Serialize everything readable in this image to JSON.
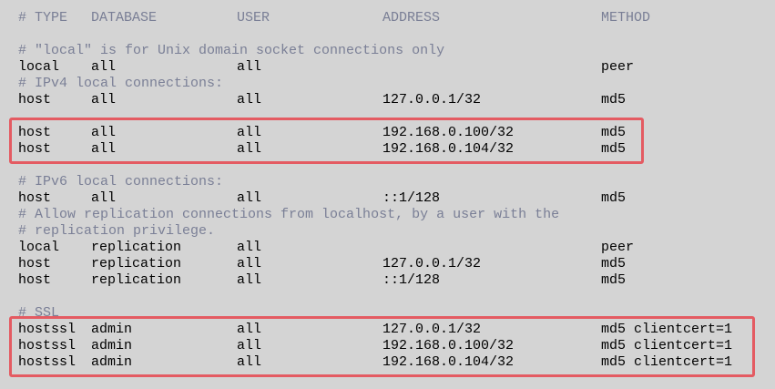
{
  "header": {
    "type": "# TYPE",
    "database": "DATABASE",
    "user": "USER",
    "address": "ADDRESS",
    "method": "METHOD"
  },
  "comments": {
    "local": "# \"local\" is for Unix domain socket connections only",
    "ipv4": "# IPv4 local connections:",
    "ipv6": "# IPv6 local connections:",
    "replication1": "# Allow replication connections from localhost, by a user with the",
    "replication2": "# replication privilege.",
    "ssl": "# SSL"
  },
  "entries": [
    {
      "type": "local",
      "database": "all",
      "user": "all",
      "address": "",
      "method": "peer"
    },
    {
      "type": "host",
      "database": "all",
      "user": "all",
      "address": "127.0.0.1/32",
      "method": "md5"
    },
    {
      "type": "host",
      "database": "all",
      "user": "all",
      "address": "192.168.0.100/32",
      "method": "md5"
    },
    {
      "type": "host",
      "database": "all",
      "user": "all",
      "address": "192.168.0.104/32",
      "method": "md5"
    },
    {
      "type": "host",
      "database": "all",
      "user": "all",
      "address": "::1/128",
      "method": "md5"
    },
    {
      "type": "local",
      "database": "replication",
      "user": "all",
      "address": "",
      "method": "peer"
    },
    {
      "type": "host",
      "database": "replication",
      "user": "all",
      "address": "127.0.0.1/32",
      "method": "md5"
    },
    {
      "type": "host",
      "database": "replication",
      "user": "all",
      "address": "::1/128",
      "method": "md5"
    },
    {
      "type": "hostssl",
      "database": "admin",
      "user": "all",
      "address": "127.0.0.1/32",
      "method": "md5 clientcert=1"
    },
    {
      "type": "hostssl",
      "database": "admin",
      "user": "all",
      "address": "192.168.0.100/32",
      "method": "md5 clientcert=1"
    },
    {
      "type": "hostssl",
      "database": "admin",
      "user": "all",
      "address": "192.168.0.104/32",
      "method": "md5 clientcert=1"
    }
  ],
  "colors": {
    "background": "#d4d4d4",
    "comment": "#7a7f96",
    "text": "#000000",
    "highlight": "#e45b62"
  }
}
